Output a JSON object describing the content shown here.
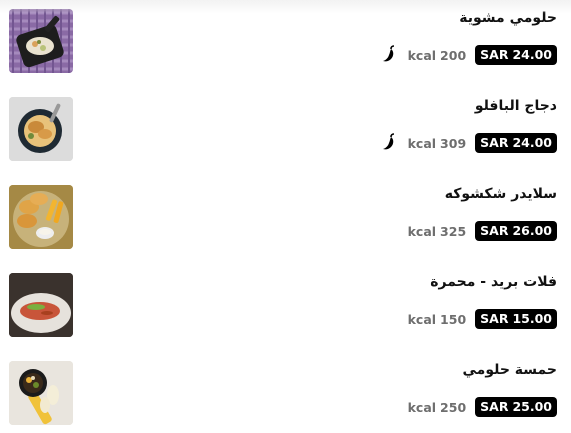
{
  "menu": {
    "items": [
      {
        "name": "حلومي مشوية",
        "price_currency": "SAR",
        "price_value": "24.00",
        "kcal_unit": "kcal",
        "kcal_value": "200",
        "spicy": true,
        "image": "grilled-halloumi-skillet"
      },
      {
        "name": "دجاج البافلو",
        "price_currency": "SAR",
        "price_value": "24.00",
        "kcal_unit": "kcal",
        "kcal_value": "309",
        "spicy": true,
        "image": "buffalo-chicken-bowl"
      },
      {
        "name": "سلايدر شكشوكه",
        "price_currency": "SAR",
        "price_value": "26.00",
        "kcal_unit": "kcal",
        "kcal_value": "325",
        "spicy": false,
        "image": "shakshuka-sliders-plate"
      },
      {
        "name": "فلات بريد - محمرة",
        "price_currency": "SAR",
        "price_value": "15.00",
        "kcal_unit": "kcal",
        "kcal_value": "150",
        "spicy": false,
        "image": "flatbread-muhammara-plate"
      },
      {
        "name": "حمسة حلومي",
        "price_currency": "SAR",
        "price_value": "25.00",
        "kcal_unit": "kcal",
        "kcal_value": "250",
        "spicy": false,
        "image": "halloumi-hamsa-skillet"
      }
    ]
  },
  "colors": {
    "badge_bg": "#000000",
    "badge_text": "#ffffff",
    "kcal_text": "#6e6e6e",
    "name_text": "#111111"
  },
  "icons": {
    "spicy": "chili-pepper-icon"
  }
}
